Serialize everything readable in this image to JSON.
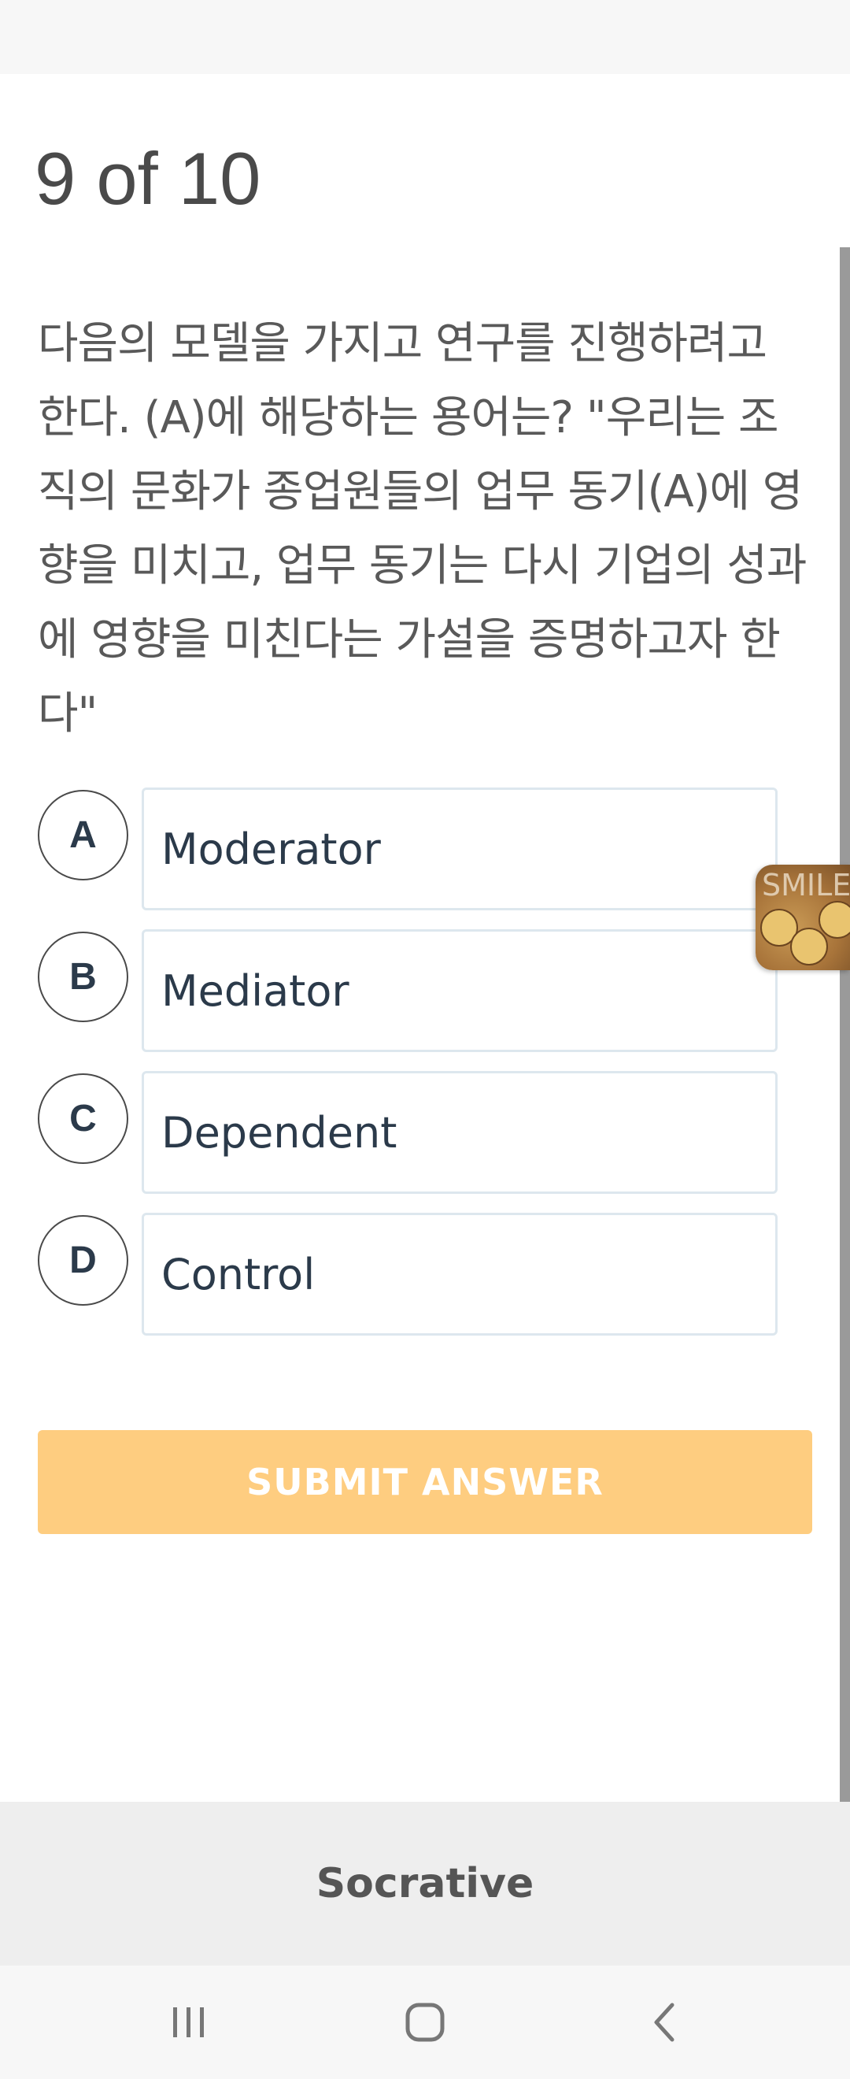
{
  "quiz": {
    "counter": "9 of 10",
    "question": "다음의 모델을 가지고 연구를 진행하려고 한다. (A)에 해당하는 용어는? \"우리는 조직의 문화가 종업원들의 업무 동기(A)에 영향을 미치고, 업무 동기는 다시 기업의 성과에 영향을 미친다는 가설을 증명하고자 한다\"",
    "options": [
      {
        "letter": "A",
        "text": "Moderator"
      },
      {
        "letter": "B",
        "text": "Mediator"
      },
      {
        "letter": "C",
        "text": "Dependent"
      },
      {
        "letter": "D",
        "text": "Control"
      }
    ],
    "submit_label": "SUBMIT ANSWER"
  },
  "sticker": {
    "label": "SMILE",
    "icon": "smiley-sticker-icon"
  },
  "footer": {
    "title": "Socrative"
  },
  "nav": {
    "icons": [
      "recent-apps-icon",
      "home-icon",
      "back-icon"
    ]
  },
  "colors": {
    "submit_bg": "#fecd80",
    "text_dark": "#2b3a4a",
    "option_border": "#dde7ee",
    "footer_bg": "#eeeeee"
  }
}
